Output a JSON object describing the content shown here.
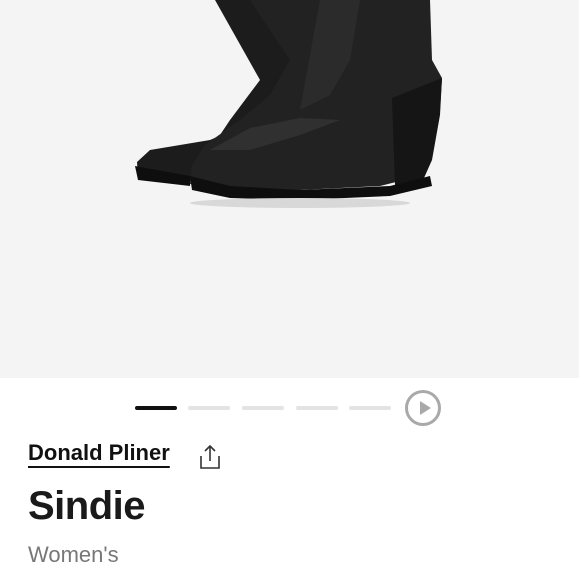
{
  "product": {
    "image_alt": "Black leather wedge ankle boots",
    "brand": "Donald Pliner",
    "name": "Sindie",
    "gender": "Women's"
  },
  "gallery": {
    "total_slides": 5,
    "active_index": 0
  },
  "icons": {
    "share": "share-icon",
    "play": "play-icon"
  },
  "colors": {
    "hero_bg": "#f4f4f4",
    "active_dot": "#111111",
    "inactive_dot": "#e3e3e3",
    "muted_text": "#777777"
  }
}
